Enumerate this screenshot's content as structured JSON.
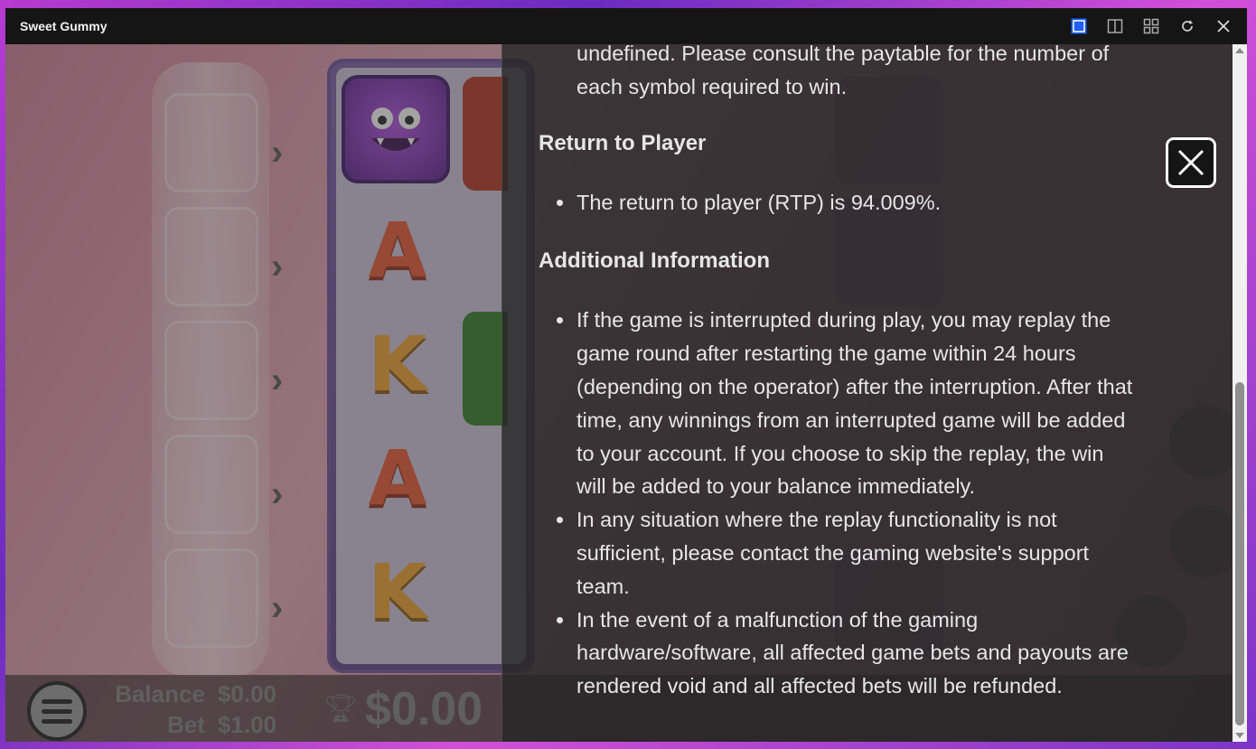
{
  "window": {
    "title": "Sweet Gummy"
  },
  "titlebar_controls": [
    {
      "name": "single-view-icon",
      "active": true
    },
    {
      "name": "split-view-icon",
      "active": false
    },
    {
      "name": "grid-view-icon",
      "active": false
    },
    {
      "name": "refresh-icon",
      "active": false
    },
    {
      "name": "close-icon",
      "active": false
    }
  ],
  "game": {
    "symbols_visible": [
      "monster",
      "A",
      "K",
      "A",
      "K"
    ],
    "balance_label": "Balance",
    "balance_value": "$0.00",
    "bet_label": "Bet",
    "bet_value": "$1.00",
    "win_value": "$0.00"
  },
  "info": {
    "intro_text": "undefined. Please consult the paytable for the number of each symbol required to win.",
    "rtp_heading": "Return to Player",
    "rtp_items": [
      "The return to player (RTP) is 94.009%."
    ],
    "additional_heading": "Additional Information",
    "additional_items": [
      "If the game is interrupted during play, you may replay the game round after restarting the game within 24 hours (depending on the operator) after the interruption. After that time, any winnings from an interrupted game will be added to your account. If you choose to skip the replay, the win will be added to your balance immediately.",
      "In any situation where the replay functionality is not sufficient, please contact the gaming website's support team.",
      "In the event of a malfunction of the gaming hardware/software, all affected game bets and payouts are rendered void and all affected bets will be refunded."
    ]
  },
  "colors": {
    "accent_blue": "#1f5fff",
    "panel_bg": "#262626",
    "text": "#e6e6e6"
  }
}
